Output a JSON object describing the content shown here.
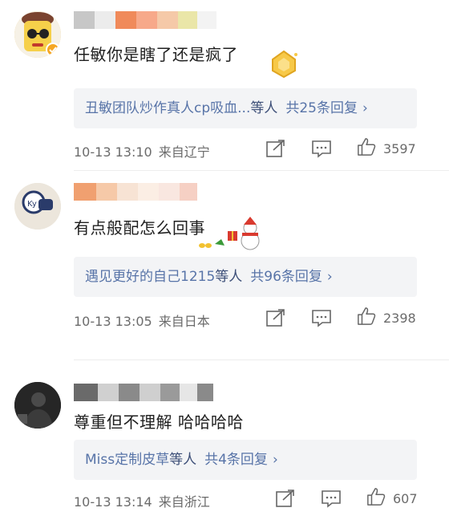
{
  "comments": [
    {
      "text": "任敏你是瞎了还是疯了",
      "reply_users": "丑敏团队炒作真人cp吸血...",
      "reply_etc": "等人",
      "reply_count": "共25条回复",
      "chevron": "›",
      "time": "10-13 13:10",
      "location": "来自辽宁",
      "likes": "3597",
      "avatar_icon": "cartoon-character-avatar",
      "sticker_icon": "gold-coin-badge-icon"
    },
    {
      "text": "有点般配怎么回事",
      "reply_users": "遇见更好的自己1215",
      "reply_etc": "等人",
      "reply_count": "共96条回复",
      "chevron": "›",
      "time": "10-13 13:05",
      "location": "来自日本",
      "likes": "2398",
      "avatar_icon": "sticker-avatar",
      "sticker_icon": "christmas-snowman-icon"
    },
    {
      "text": "尊重但不理解 哈哈哈哈",
      "reply_users": "Miss定制皮草",
      "reply_etc": "等人",
      "reply_count": "共4条回复",
      "chevron": "›",
      "time": "10-13 13:14",
      "location": "来自浙江",
      "likes": "607",
      "avatar_icon": "photo-avatar"
    }
  ],
  "colors": {
    "reply_bg": "#f3f4f6",
    "link_blue": "#5874a8",
    "meta_gray": "#6b6b6b"
  }
}
